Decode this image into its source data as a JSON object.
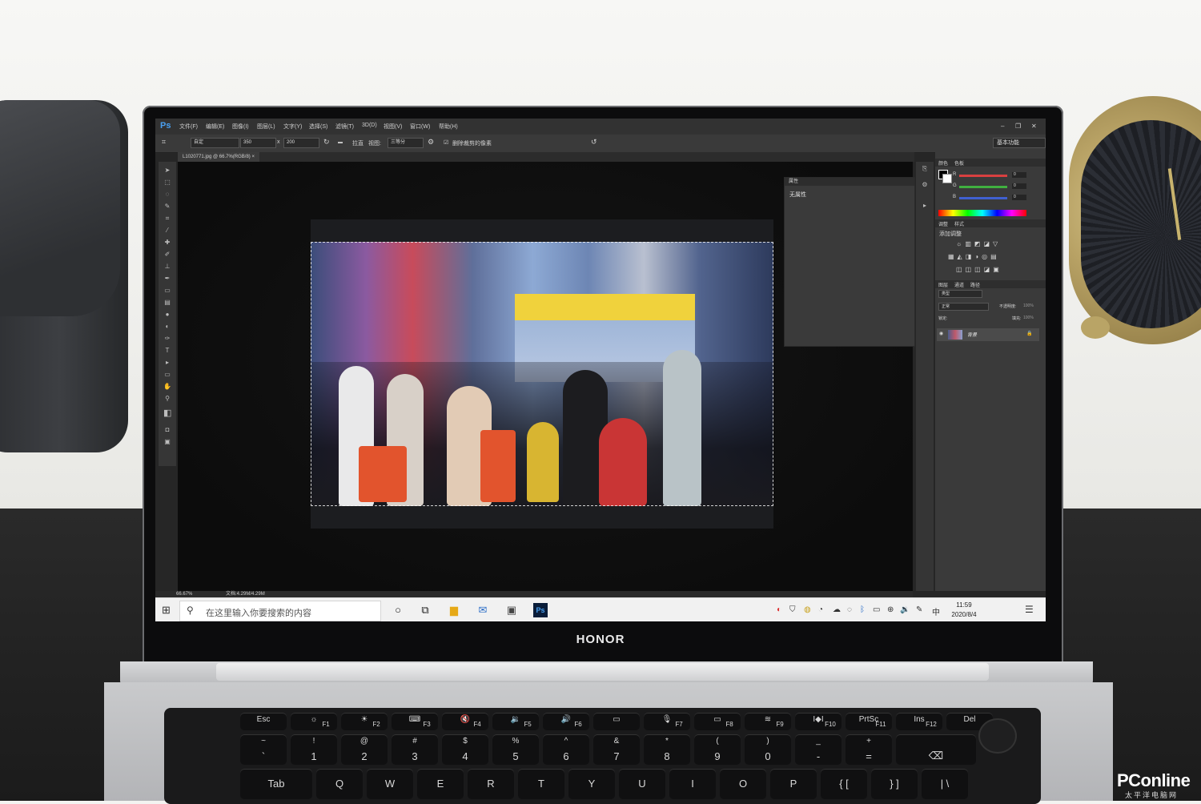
{
  "photoshop": {
    "app_icon": "Ps",
    "menu": [
      "文件(F)",
      "编辑(E)",
      "图像(I)",
      "图层(L)",
      "文字(Y)",
      "选择(S)",
      "滤镜(T)",
      "3D(D)",
      "视图(V)",
      "窗口(W)",
      "帮助(H)"
    ],
    "window_controls": [
      "–",
      "❐",
      "✕"
    ],
    "options": {
      "ratio_select": "自定",
      "width": "350",
      "times": "x",
      "height": "200",
      "straighten_label": "拉直",
      "view_label": "视图:",
      "view_select": "三等分",
      "delete_cropped_label": "删除裁剪的像素",
      "workspace": "基本功能"
    },
    "document_tab": "L1020771.jpg @ 66.7%(RGB/8)",
    "document_tab_close": "×",
    "properties_panel": {
      "title": "属性",
      "body": "无属性"
    },
    "color_panel": {
      "tabs": [
        "颜色",
        "色板"
      ],
      "channels": [
        {
          "label": "R",
          "value": "0",
          "color": "#d94040"
        },
        {
          "label": "G",
          "value": "0",
          "color": "#40b040"
        },
        {
          "label": "B",
          "value": "0",
          "color": "#4060d0"
        }
      ]
    },
    "adjust_panel": {
      "tabs": [
        "调整",
        "样式"
      ],
      "add_label": "添加调整"
    },
    "layers_panel": {
      "tabs": [
        "图层",
        "通道",
        "路径"
      ],
      "kind_filter": "类型",
      "blend_mode": "正常",
      "opacity_label": "不透明度:",
      "opacity_value": "100%",
      "lock_label": "锁定:",
      "fill_label": "填充:",
      "fill_value": "100%",
      "layer_name": "背景"
    },
    "status": {
      "zoom": "66.67%",
      "doc": "文档:4.29M/4.29M"
    }
  },
  "taskbar": {
    "search_placeholder": "在这里输入你要搜索的内容",
    "ime": "中",
    "time": "11:59",
    "date": "2020/8/4"
  },
  "laptop": {
    "brand": "HONOR"
  },
  "keyboard": {
    "fn_row": [
      {
        "top": "Esc",
        "bottom": ""
      },
      {
        "top": "☼",
        "bottom": "F1"
      },
      {
        "top": "☀",
        "bottom": "F2"
      },
      {
        "top": "⌨",
        "bottom": "F3"
      },
      {
        "top": "🔇",
        "bottom": "F4"
      },
      {
        "top": "🔉",
        "bottom": "F5"
      },
      {
        "top": "🔊",
        "bottom": "F6"
      },
      {
        "top": "▭",
        "bottom": ""
      },
      {
        "top": "🎙",
        "bottom": "F7"
      },
      {
        "top": "▭",
        "bottom": "F8"
      },
      {
        "top": "≋",
        "bottom": "F9"
      },
      {
        "top": "I◆I",
        "bottom": "F10"
      },
      {
        "top": "PrtSc",
        "bottom": "F11"
      },
      {
        "top": "Ins",
        "bottom": "F12"
      },
      {
        "top": "Del",
        "bottom": ""
      }
    ],
    "number_row": [
      {
        "top": "~",
        "bottom": "`"
      },
      {
        "top": "!",
        "bottom": "1"
      },
      {
        "top": "@",
        "bottom": "2"
      },
      {
        "top": "#",
        "bottom": "3"
      },
      {
        "top": "$",
        "bottom": "4"
      },
      {
        "top": "%",
        "bottom": "5"
      },
      {
        "top": "^",
        "bottom": "6"
      },
      {
        "top": "&",
        "bottom": "7"
      },
      {
        "top": "*",
        "bottom": "8"
      },
      {
        "top": "(",
        "bottom": "9"
      },
      {
        "top": ")",
        "bottom": "0"
      },
      {
        "top": "_",
        "bottom": "-"
      },
      {
        "top": "+",
        "bottom": "="
      },
      {
        "top": "",
        "bottom": "⌫"
      }
    ],
    "letter_row": [
      "Tab",
      "Q",
      "W",
      "E",
      "R",
      "T",
      "Y",
      "U",
      "I",
      "O",
      "P",
      "{ [",
      "} ]",
      "| \\"
    ]
  },
  "watermark": {
    "brand": "PConline",
    "sub": "太平洋电脑网"
  }
}
